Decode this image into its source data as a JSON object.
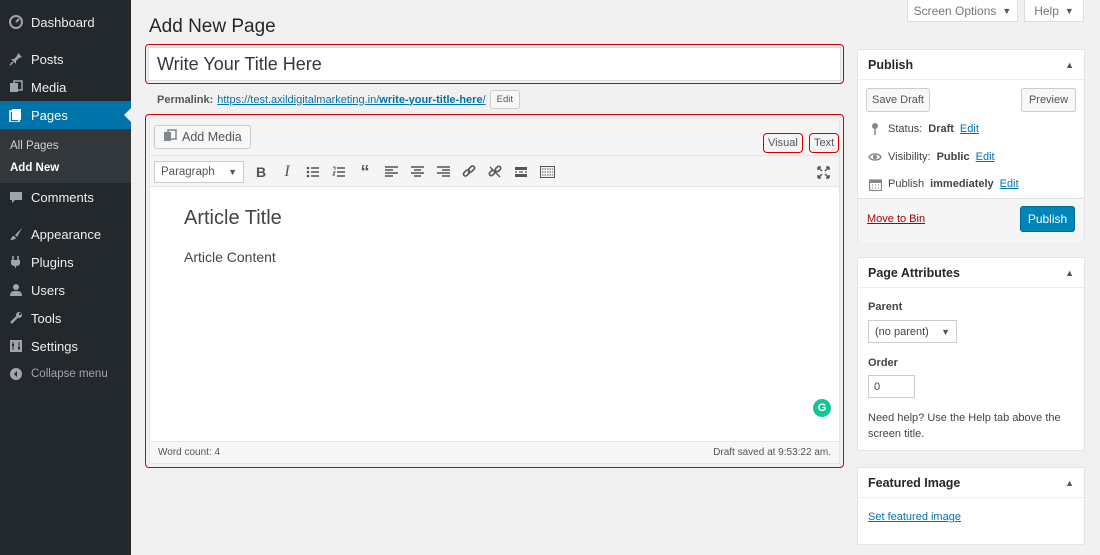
{
  "sidebar": {
    "items": [
      {
        "label": "Dashboard",
        "icon": "dashboard-icon"
      },
      {
        "label": "Posts",
        "icon": "pin-icon"
      },
      {
        "label": "Media",
        "icon": "media-icon"
      },
      {
        "label": "Pages",
        "icon": "page-icon"
      },
      {
        "label": "Comments",
        "icon": "comment-icon"
      },
      {
        "label": "Appearance",
        "icon": "brush-icon"
      },
      {
        "label": "Plugins",
        "icon": "plugin-icon"
      },
      {
        "label": "Users",
        "icon": "user-icon"
      },
      {
        "label": "Tools",
        "icon": "wrench-icon"
      },
      {
        "label": "Settings",
        "icon": "settings-icon"
      },
      {
        "label": "Collapse menu",
        "icon": "collapse-icon"
      }
    ],
    "submenu": [
      "All Pages",
      "Add New"
    ]
  },
  "screen_options": "Screen Options",
  "help": "Help",
  "page_title": "Add New Page",
  "title_input": "Write Your Title Here",
  "permalink": {
    "label": "Permalink:",
    "base": "https://test.axildigitalmarketing.in/",
    "slug": "write-your-title-here",
    "trail": "/",
    "edit": "Edit"
  },
  "editor": {
    "add_media": "Add Media",
    "tab_visual": "Visual",
    "tab_text": "Text",
    "format": "Paragraph",
    "content_title": "Article Title",
    "content_body": "Article Content",
    "word_count": "Word count: 4",
    "draft_saved": "Draft saved at 9:53:22 am."
  },
  "publish_box": {
    "title": "Publish",
    "save_draft": "Save Draft",
    "preview": "Preview",
    "status_label": "Status:",
    "status_value": "Draft",
    "visibility_label": "Visibility:",
    "visibility_value": "Public",
    "publish_label": "Publish",
    "publish_value": "immediately",
    "edit": "Edit",
    "move_to_bin": "Move to Bin",
    "publish_button": "Publish"
  },
  "page_attributes": {
    "title": "Page Attributes",
    "parent_label": "Parent",
    "parent_value": "(no parent)",
    "order_label": "Order",
    "order_value": "0",
    "help_text": "Need help? Use the Help tab above the screen title."
  },
  "featured_image": {
    "title": "Featured Image",
    "link": "Set featured image"
  },
  "colors": {
    "sidebar_bg": "#23282d",
    "accent": "#0073aa",
    "highlight_border": "#d40000",
    "publish_button": "#0085ba"
  }
}
